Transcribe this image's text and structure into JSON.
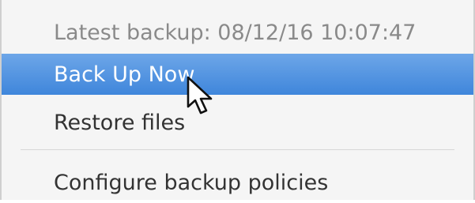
{
  "menu": {
    "latest_backup": "Latest backup: 08/12/16 10:07:47",
    "back_up_now": "Back Up Now",
    "restore_files": "Restore files",
    "configure_policies": "Configure backup policies"
  },
  "colors": {
    "highlight_top": "#6da6e8",
    "highlight_bottom": "#3f86db",
    "menu_background": "#f5f5f5",
    "header_text": "#8a8a8a"
  },
  "cursor": {
    "icon": "mouse-pointer-arrow-icon"
  }
}
